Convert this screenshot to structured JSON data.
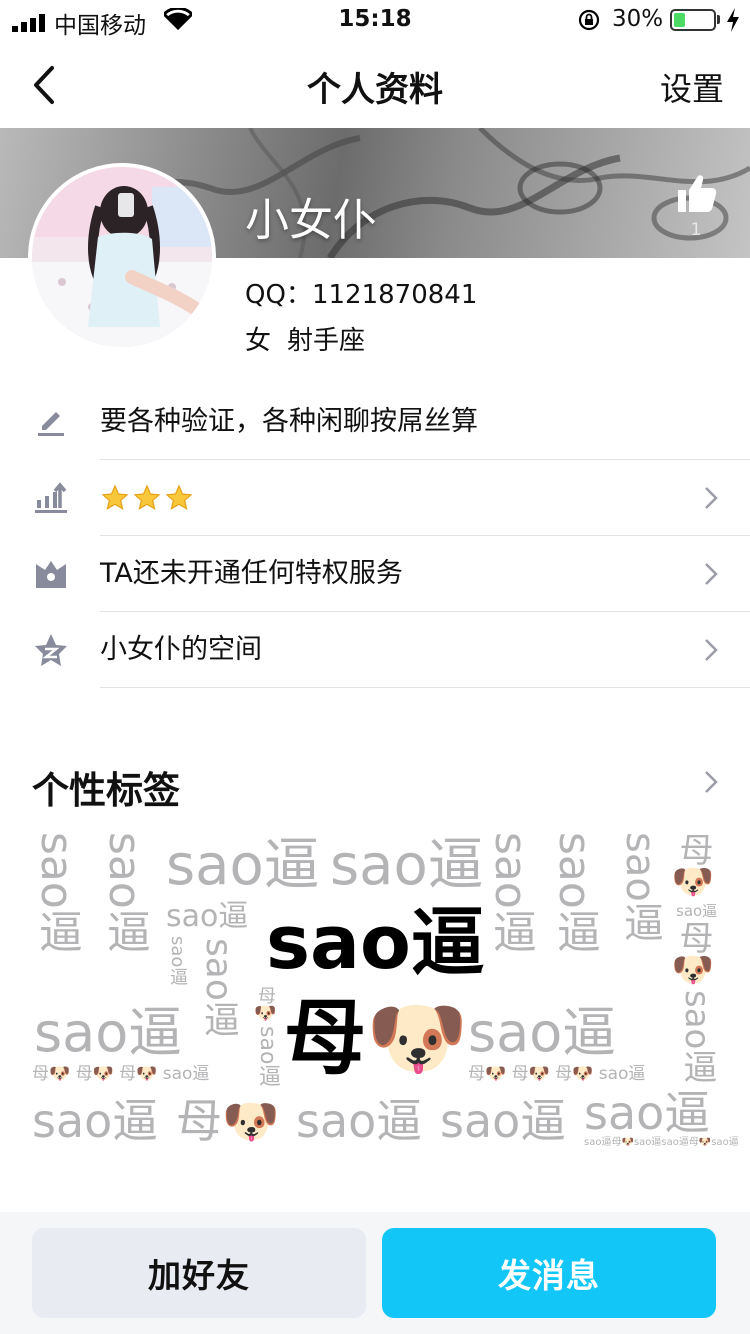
{
  "status_bar": {
    "carrier": "中国移动",
    "time": "15:18",
    "battery": "30%",
    "battery_level": 0.3
  },
  "nav": {
    "title": "个人资料",
    "settings_label": "设置"
  },
  "profile": {
    "nickname": "小女仆",
    "like_count": "1",
    "qq_label": "QQ：",
    "qq_number": "1121870841",
    "gender": "女",
    "constellation": "射手座"
  },
  "rows": {
    "signature": "要各种验证，各种闲聊按屌丝算",
    "level_stars": "⭐⭐⭐",
    "privilege": "TA还未开通任何特权服务",
    "space": "小女仆的空间"
  },
  "tags": {
    "title": "个性标签",
    "main_word": "sao逼",
    "main_word_2": "母🐶",
    "cloud_words": [
      "sao逼",
      "母🐶",
      "sao逼母🐶sao逼sao逼母🐶sao逼",
      "母🐶 母🐶 母🐶 sao逼",
      "母🐶 母🐶 母🐶 sao逼"
    ]
  },
  "actions": {
    "add_friend": "加好友",
    "send_message": "发消息"
  },
  "colors": {
    "accent": "#12c7f8",
    "secondary_button": "#e8ebf1",
    "cloud_text": "#b4b4b6",
    "icon_gray": "#878b9c"
  }
}
